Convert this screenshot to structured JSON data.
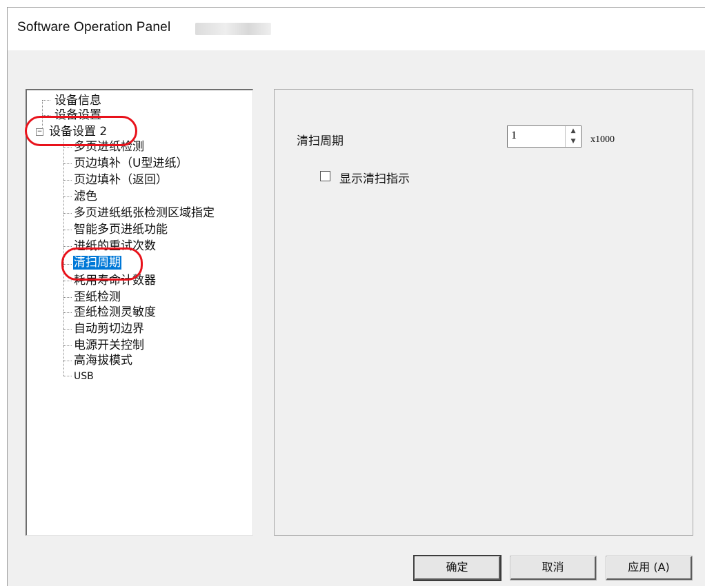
{
  "window": {
    "title": "Software Operation Panel"
  },
  "tree": {
    "items": [
      {
        "label": "设备信息"
      },
      {
        "label": "设备设置"
      },
      {
        "label": "设备设置 2",
        "expanded": true
      },
      {
        "label": "多页进纸检测"
      },
      {
        "label": "页边填补（U型进纸）"
      },
      {
        "label": "页边填补（返回）"
      },
      {
        "label": "滤色"
      },
      {
        "label": "多页进纸纸张检测区域指定"
      },
      {
        "label": "智能多页进纸功能"
      },
      {
        "label": "进纸的重试次数"
      },
      {
        "label": "清扫周期",
        "selected": true
      },
      {
        "label": "耗用寿命计数器"
      },
      {
        "label": "歪纸检测"
      },
      {
        "label": "歪纸检测灵敏度"
      },
      {
        "label": "自动剪切边界"
      },
      {
        "label": "电源开关控制"
      },
      {
        "label": "高海拔模式"
      },
      {
        "label": "USB"
      }
    ],
    "expander_symbol": "−"
  },
  "settings": {
    "cleaning_cycle_label": "清扫周期",
    "cleaning_cycle_value": "1",
    "unit_label": "x1000",
    "spin_up": "▲",
    "spin_down": "▼",
    "show_cleaning_indicator_label": "显示清扫指示",
    "show_cleaning_indicator_checked": false
  },
  "buttons": {
    "ok": "确定",
    "cancel": "取消",
    "apply": "应用 (A)"
  },
  "colors": {
    "selection": "#0078d7",
    "annotation": "#e8121b"
  }
}
